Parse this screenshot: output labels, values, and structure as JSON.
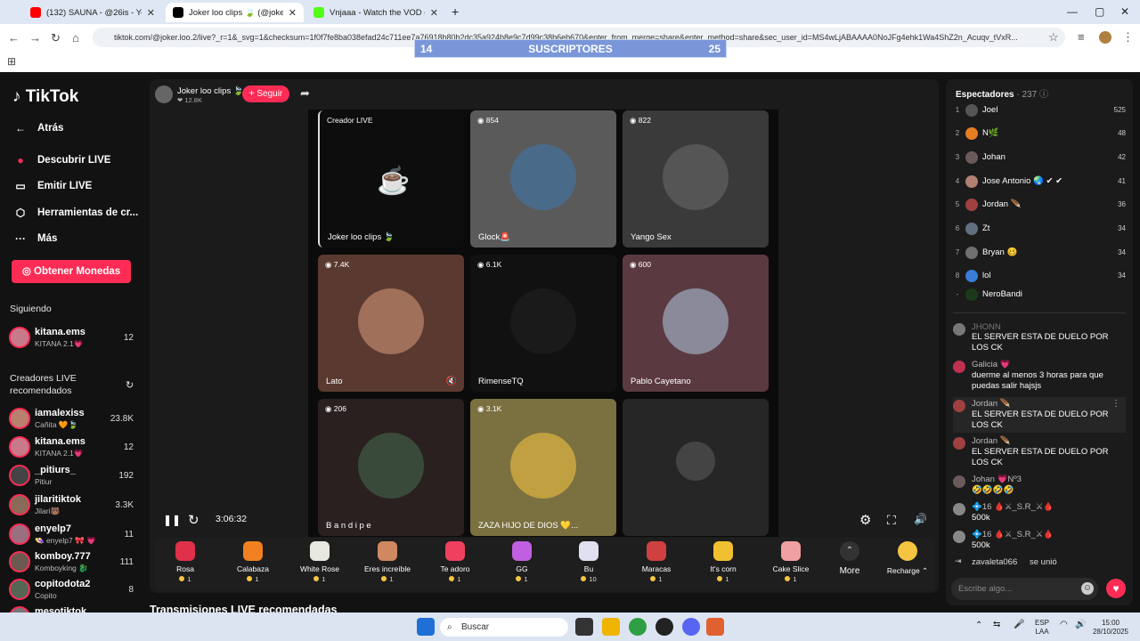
{
  "browser": {
    "tabs": [
      {
        "title": "(132) SAUNA - @26is - YouTube",
        "close": "✕",
        "color": "#ff0000"
      },
      {
        "title": "Joker loo clips 🍃 (@joker.l",
        "close": "✕",
        "color": "#000000"
      },
      {
        "title": "Vnjaaa - Watch the VOD on Kick",
        "close": "✕",
        "color": "#53fc18"
      }
    ],
    "new_tab": "+",
    "url": "tiktok.com/@joker.loo.2/live?_r=1&_svg=1&checksum=1f0f7fe8ba038efad24c711ee7a76918b80b2dc35a924b8e9c7d99c38b6eb670&enter_from_merge=share&enter_method=share&sec_user_id=MS4wLjABAAAA0NoJFg4ehk1Wa4ShZ2n_Acuqv_tVxR...",
    "subscriber_bar": {
      "left": "14",
      "center": "SUSCRIPTORES",
      "right": "25"
    }
  },
  "sidebar": {
    "logo": "TikTok",
    "nav": [
      {
        "label": "Atrás",
        "icon": "←"
      },
      {
        "label": "Descubrir LIVE",
        "icon": "●"
      },
      {
        "label": "Emitir LIVE",
        "icon": "▭"
      },
      {
        "label": "Herramientas de cr...",
        "icon": "⬡"
      },
      {
        "label": "Más",
        "icon": "···"
      }
    ],
    "coins_button": "Obtener Monedas",
    "following_header": "Siguiendo",
    "following": [
      {
        "name": "kitana.ems",
        "sub": "KITANA 2.1💗",
        "count": "12",
        "color": "#c97a8a"
      }
    ],
    "recommended_header": "Creadores LIVE\nrecomendados",
    "recommended_h1": "Creadores LIVE",
    "recommended_h2": "recomendados",
    "recommended": [
      {
        "name": "iamalexiss",
        "sub": "Cañita 🧡🍃",
        "count": "23.8K",
        "color": "#b98070"
      },
      {
        "name": "kitana.ems",
        "sub": "KITANA 2.1💗",
        "count": "12",
        "color": "#c97a8a"
      },
      {
        "name": "_pitiurs_",
        "sub": "Pitiur",
        "count": "192",
        "color": "#444"
      },
      {
        "name": "jilaritiktok",
        "sub": "Jilari🐻",
        "count": "3.3K",
        "color": "#8a6a58"
      },
      {
        "name": "enyelp7",
        "sub": "👒 enyelp7 🎀 💗",
        "count": "11",
        "color": "#9a7080"
      },
      {
        "name": "komboy.777",
        "sub": "Komboyking 🐉",
        "count": "111",
        "color": "#6a5a50"
      },
      {
        "name": "copitodota2",
        "sub": "Copito",
        "count": "8",
        "color": "#556655"
      },
      {
        "name": "mesotiktok",
        "sub": "",
        "count": "",
        "color": "#777"
      }
    ]
  },
  "host": {
    "name": "Joker loo clips 🍃",
    "likes": "❤ 12.8K",
    "follow": "+ Seguir"
  },
  "grid": [
    {
      "label": "Joker loo clips 🍃",
      "viewers": "Creador LIVE",
      "bg": "#0d0d0d",
      "face": ""
    },
    {
      "label": "Glock🚨",
      "viewers": "854",
      "bg": "#5a5a5a",
      "face": "#4a6a8a"
    },
    {
      "label": "Yango Sex",
      "viewers": "822",
      "bg": "#3a3a3a",
      "face": "#555555"
    },
    {
      "label": "Lato",
      "viewers": "7.4K",
      "bg": "#5a3a30",
      "face": "#a0705a"
    },
    {
      "label": "RimenseTQ",
      "viewers": "6.1K",
      "bg": "#111111",
      "face": "#1a1a1a"
    },
    {
      "label": "Pablo Cayetano",
      "viewers": "600",
      "bg": "#5a3a40",
      "face": "#8a8a9a"
    },
    {
      "label": "B a n d i p e",
      "viewers": "206",
      "bg": "#2a2020",
      "face": "#3a4a3a"
    },
    {
      "label": "ZAZA HIJO DE DIOS 💛...",
      "viewers": "3.1K",
      "bg": "#7a7040",
      "face": "#c0a040"
    },
    {
      "label": "",
      "viewers": "",
      "bg": "#262626",
      "face": ""
    }
  ],
  "controls": {
    "pause": "❚❚",
    "refresh": "↻",
    "timer": "3:06:32",
    "settings": "⚙",
    "fullscreen": "⛶",
    "volume": "🔊"
  },
  "gifts": [
    {
      "name": "Rosa",
      "price": "1",
      "color": "#e0304a"
    },
    {
      "name": "Calabaza",
      "price": "1",
      "color": "#f08020"
    },
    {
      "name": "White Rose",
      "price": "1",
      "color": "#e8e8e0"
    },
    {
      "name": "Eres increíble",
      "price": "1",
      "color": "#d08860"
    },
    {
      "name": "Te adoro",
      "price": "1",
      "color": "#f04060"
    },
    {
      "name": "GG",
      "price": "1",
      "color": "#c060e0"
    },
    {
      "name": "Bu",
      "price": "10",
      "color": "#e0e0f0"
    },
    {
      "name": "Maracas",
      "price": "1",
      "color": "#d04040"
    },
    {
      "name": "It's corn",
      "price": "1",
      "color": "#f0c030"
    },
    {
      "name": "Cake Slice",
      "price": "1",
      "color": "#f0a0a0"
    }
  ],
  "gift_more": "More",
  "recharge": "Recharge ⌃",
  "recommended_lives": "Transmisiones LIVE recomendadas",
  "viewers_panel": {
    "title": "Espectadores",
    "count": "· 237",
    "list": [
      {
        "rank": "1",
        "name": "Joel",
        "score": "525",
        "color": "#555"
      },
      {
        "rank": "2",
        "name": "N🌿",
        "score": "48",
        "color": "#e67e22"
      },
      {
        "rank": "3",
        "name": "Johan",
        "score": "42",
        "color": "#6a5a5a"
      },
      {
        "rank": "4",
        "name": "Jose Antonio 🌏 ✔ ✔",
        "score": "41",
        "color": "#b08070"
      },
      {
        "rank": "5",
        "name": "Jordan 🪶",
        "score": "36",
        "color": "#a04040"
      },
      {
        "rank": "6",
        "name": "Zt",
        "score": "34",
        "color": "#607080"
      },
      {
        "rank": "7",
        "name": "Bryan 🥴",
        "score": "34",
        "color": "#707070"
      },
      {
        "rank": "8",
        "name": "lol",
        "score": "34",
        "color": "#3a7bd5"
      },
      {
        "rank": "-",
        "name": "NeroBandi",
        "score": "",
        "color": "#1a3a1a"
      }
    ]
  },
  "chat": [
    {
      "name": "JHONN",
      "text": "EL SERVER ESTA DE DUELO POR LOS CK",
      "color": "#777"
    },
    {
      "name": "Galicia 💗",
      "text": "duerme al menos 3 horas para que puedas salir hajsjs",
      "color": "#c03050"
    },
    {
      "name": "Jordan 🪶",
      "text": "EL SERVER ESTA DE DUELO POR LOS CK",
      "color": "#a04040"
    },
    {
      "name": "Jordan 🪶",
      "text": "EL SERVER ESTA DE DUELO POR LOS CK",
      "color": "#a04040"
    },
    {
      "name": "Johan 💗Nº3",
      "text": "🤣🤣🤣🤣",
      "color": "#6a5a5a"
    },
    {
      "name": "💠16 🩸⚔_S.R_⚔🩸",
      "text": "500k",
      "color": "#888"
    },
    {
      "name": "💠16 🩸⚔_S.R_⚔🩸",
      "text": "500k",
      "color": "#888"
    }
  ],
  "join_notice": {
    "user": "zavaleta066",
    "text": "se unió"
  },
  "chat_input_placeholder": "Escribe algo...",
  "taskbar": {
    "search": "Buscar",
    "lang": "ESP\nLAA",
    "lang1": "ESP",
    "lang2": "LAA",
    "time": "15:00",
    "date": "28/10/2025"
  }
}
